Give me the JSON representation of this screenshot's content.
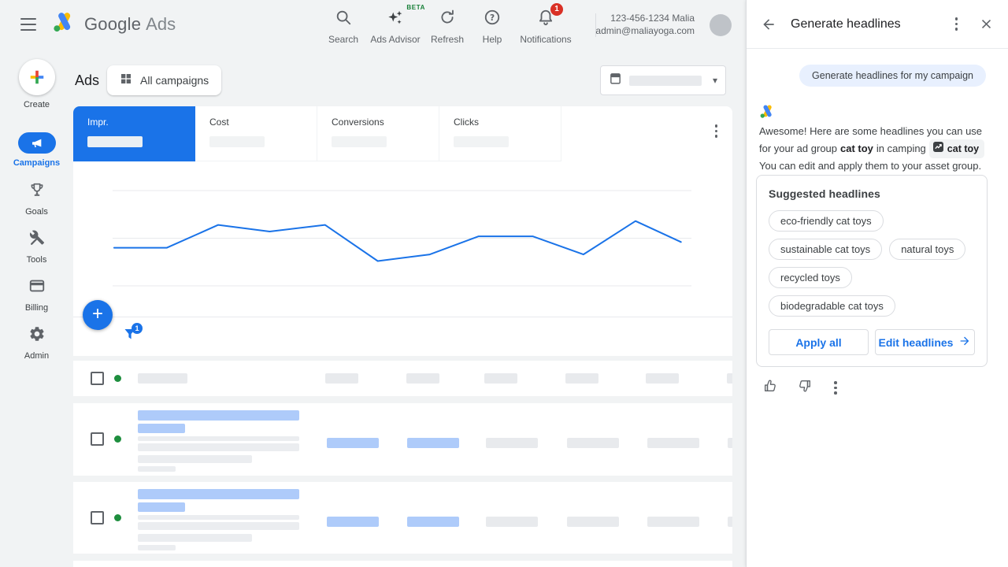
{
  "colors": {
    "accent_blue": "#1a73e8",
    "light_blue_bar": "#aecbfa",
    "skeleton_gray": "#e8eaed",
    "background_gray": "#f1f3f4",
    "bubble_blue": "#e8f0fe",
    "badge_red": "#d93025",
    "beta_green": "#188038",
    "status_green": "#1e8e3e"
  },
  "topbar": {
    "brand": {
      "google": "Google",
      "product": "Ads"
    },
    "nav": [
      {
        "label": "Search",
        "icon": "search-icon"
      },
      {
        "label": "Ads Advisor",
        "icon": "sparkle-icon",
        "badge": "BETA"
      },
      {
        "label": "Refresh",
        "icon": "refresh-icon"
      },
      {
        "label": "Help",
        "icon": "help-icon"
      },
      {
        "label": "Notifications",
        "icon": "bell-icon",
        "badge": "1"
      }
    ],
    "account": {
      "name_line": "123-456-1234 Malia",
      "email_line": "admin@maliayoga.com"
    }
  },
  "sidebar": {
    "items": [
      {
        "label": "Create",
        "icon": "plus-multicolor-icon",
        "active": false
      },
      {
        "label": "Campaigns",
        "icon": "megaphone-icon",
        "active": true
      },
      {
        "label": "Goals",
        "icon": "trophy-icon",
        "active": false
      },
      {
        "label": "Tools",
        "icon": "tools-icon",
        "active": false
      },
      {
        "label": "Billing",
        "icon": "credit-card-icon",
        "active": false
      },
      {
        "label": "Admin",
        "icon": "gear-icon",
        "active": false
      }
    ]
  },
  "main": {
    "page_title": "Ads",
    "scope_chip_label": "All campaigns",
    "metric_tabs": [
      {
        "label": "Impr.",
        "selected": true
      },
      {
        "label": "Cost",
        "selected": false
      },
      {
        "label": "Conversions",
        "selected": false
      },
      {
        "label": "Clicks",
        "selected": false
      }
    ],
    "fab_label": "+",
    "filter_badge_count": "1"
  },
  "chart_data": {
    "type": "line",
    "series": [
      {
        "name": "Impr.",
        "values": [
          40,
          40,
          64,
          57,
          64,
          26,
          33,
          52,
          52,
          33,
          68,
          46
        ]
      }
    ],
    "x_fraction": [
      0.062,
      0.142,
      0.22,
      0.298,
      0.382,
      0.462,
      0.541,
      0.615,
      0.697,
      0.774,
      0.853,
      0.922
    ],
    "ylim": [
      0,
      100
    ],
    "gridlines_at": [
      100,
      50,
      0
    ],
    "line_color": "#1a73e8",
    "axis_labels_visible": false,
    "title": "",
    "xlabel": "",
    "ylabel": ""
  },
  "assistant_panel": {
    "title": "Generate headlines",
    "user_message": "Generate headlines for my campaign",
    "ai_message": {
      "line1": "Awesome! Here are some headlines you can use",
      "line2_prefix": "for your ad group",
      "ad_group_name": "cat toy",
      "line2_suffix": "in camping",
      "keyword_chip": "cat toy",
      "line3": "You can edit and apply them to your asset group."
    },
    "suggestions_card": {
      "title": "Suggested headlines",
      "headlines": [
        "eco-friendly cat toys",
        "sustainable cat toys",
        "natural toys",
        "recycled toys",
        "biodegradable cat toys"
      ],
      "apply_all_label": "Apply all",
      "edit_headlines_label": "Edit headlines"
    }
  }
}
